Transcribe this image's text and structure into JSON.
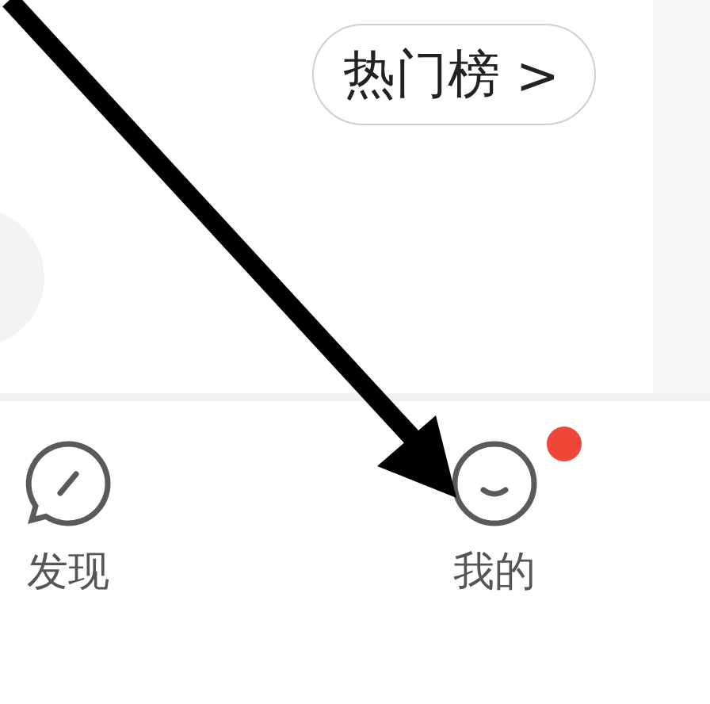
{
  "hot_list_button": {
    "label": "热门榜",
    "chevron": ">"
  },
  "tabs": [
    {
      "label": "发现",
      "kind": "discover",
      "selected": false,
      "badge": false
    },
    {
      "label": "我的",
      "kind": "profile",
      "selected": false,
      "badge": true
    }
  ]
}
